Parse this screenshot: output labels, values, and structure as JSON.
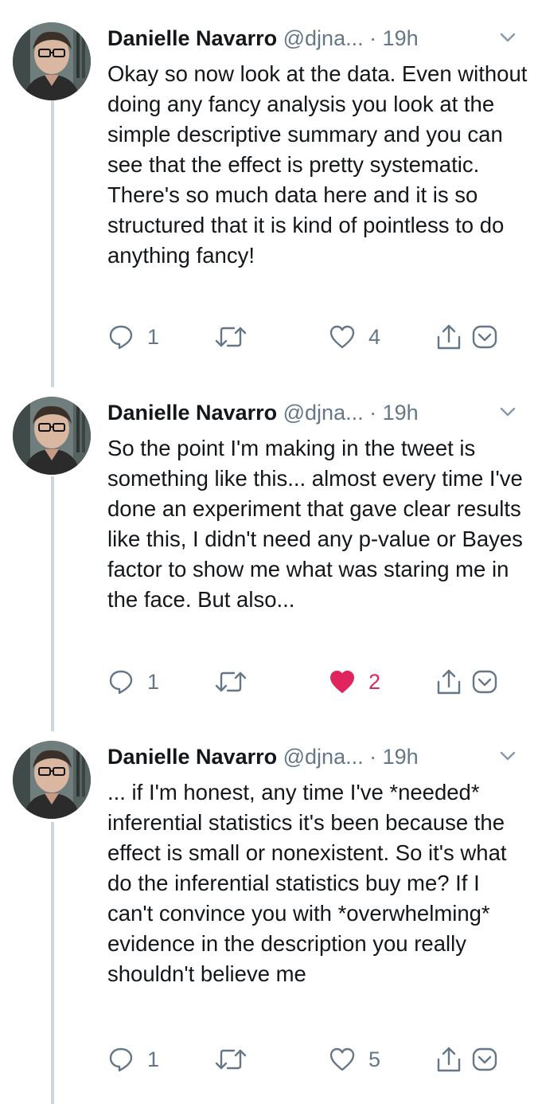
{
  "colors": {
    "text": "#14171a",
    "muted": "#657786",
    "like_active": "#e0245e",
    "thread_line": "#ccd6dd"
  },
  "tweets": [
    {
      "name": "Danielle Navarro",
      "handle": "@djna...",
      "dot": "·",
      "time": "19h",
      "text": "Okay so now look at the data. Even without doing any fancy analysis you look at the simple descriptive summary and you can see that the effect is pretty systematic. There's so much data here and it is so structured that it is kind of pointless to do anything fancy!",
      "replies": "1",
      "retweets": "",
      "likes": "4",
      "liked": false
    },
    {
      "name": "Danielle Navarro",
      "handle": "@djna...",
      "dot": "·",
      "time": "19h",
      "text": "So the point I'm making in the tweet is something like this... almost every time I've done an experiment that gave clear results like this, I didn't need any p-value or Bayes factor to show me what was staring me in the face. But also...",
      "replies": "1",
      "retweets": "",
      "likes": "2",
      "liked": true
    },
    {
      "name": "Danielle Navarro",
      "handle": "@djna...",
      "dot": "·",
      "time": "19h",
      "text": "... if I'm honest, any time I've *needed* inferential statistics it's been because the effect is small or nonexistent. So it's what do the inferential statistics buy me? If I can't convince you with *overwhelming* evidence in the description you really shouldn't believe me",
      "replies": "1",
      "retweets": "",
      "likes": "5",
      "liked": false
    }
  ]
}
